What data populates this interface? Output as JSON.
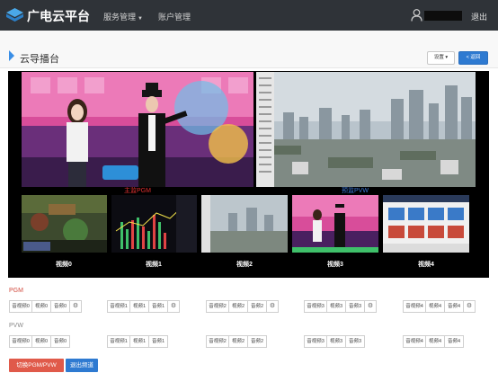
{
  "app": {
    "title": "广电云平台"
  },
  "nav": {
    "service": "服务管理",
    "account": "账户管理",
    "logout": "退出"
  },
  "page": {
    "title": "云导播台",
    "settings": "设置",
    "back": "< 返回"
  },
  "monitor": {
    "pgm_label": "主监PGM",
    "pvw_label": "预监PVW",
    "thumbs": [
      "视频0",
      "视频1",
      "视频2",
      "视频3",
      "视频4"
    ]
  },
  "pgm": {
    "label": "PGM",
    "groups": [
      [
        "音视频0",
        "视频0",
        "音频0",
        "⚙"
      ],
      [
        "音视频1",
        "视频1",
        "音频1",
        "⚙"
      ],
      [
        "音视频2",
        "视频2",
        "音频2",
        "⚙"
      ],
      [
        "音视频3",
        "视频3",
        "音频3",
        "⚙"
      ],
      [
        "音视频4",
        "视频4",
        "音频4",
        "⚙"
      ]
    ]
  },
  "pvw": {
    "label": "PVW",
    "groups": [
      [
        "音视频0",
        "视频0",
        "音频0"
      ],
      [
        "音视频1",
        "视频1",
        "音频1"
      ],
      [
        "音视频2",
        "视频2",
        "音频2"
      ],
      [
        "音视频3",
        "视频3",
        "音频3"
      ],
      [
        "音视频4",
        "视频4",
        "音频4"
      ]
    ]
  },
  "actions": {
    "switch": "切换PGM/PVW",
    "exit": "退出频道"
  },
  "colors": {
    "topbar": "#2f3338",
    "accent_blue": "#2e7ad1",
    "pgm_red": "#e03030",
    "pvw_blue": "#3a78d8",
    "switch_red": "#e05a4a"
  }
}
